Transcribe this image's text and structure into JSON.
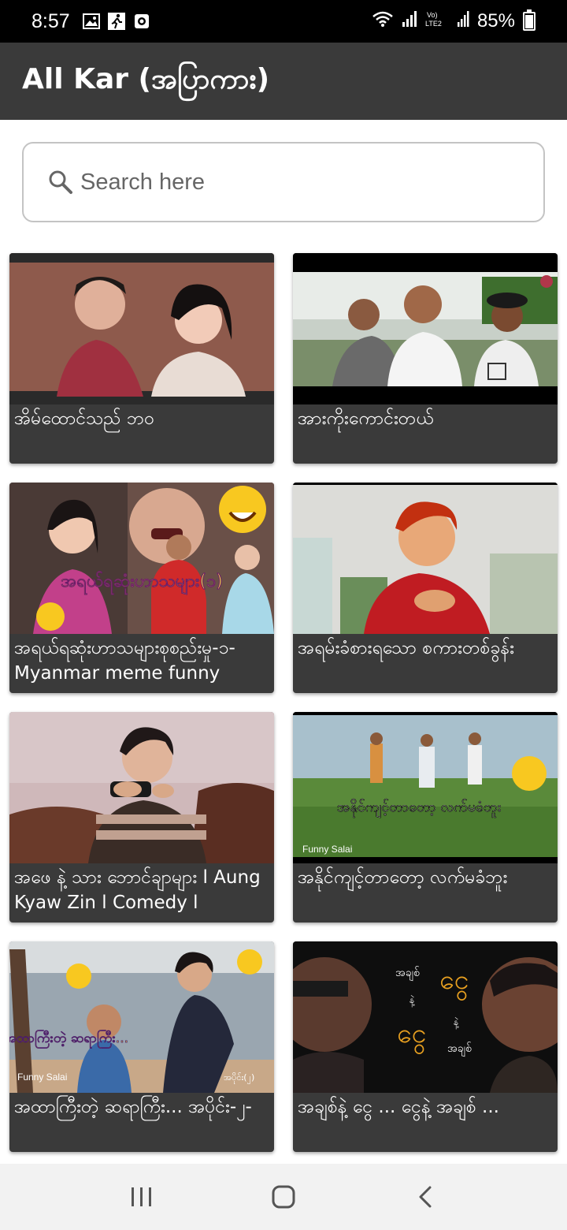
{
  "status_bar": {
    "time": "8:57",
    "battery": "85%",
    "battery_level": 0.85,
    "icons": [
      "gallery-icon",
      "running-app-icon",
      "record-icon",
      "wifi-icon",
      "signal-icon",
      "volte-icon",
      "signal-2-icon",
      "battery-icon"
    ],
    "volte_label": "Vo)\nLTE2"
  },
  "app_bar": {
    "title": "All Kar (အပြာကား)",
    "background": "#3a3a3a"
  },
  "search": {
    "placeholder": "Search here",
    "value": ""
  },
  "videos": [
    {
      "title": "အိမ်ထောင်သည် ဘဝ"
    },
    {
      "title": "အားကိုးကောင်းတယ်"
    },
    {
      "title": "အရယ်ရဆုံးဟာသများစုစည်းမှု-၁- Myanmar meme funny",
      "overlay": "အရယ်ရဆုံးဟာသများ(၁)"
    },
    {
      "title": "အရမ်းခံစားရသော စကားတစ်ခွန်း"
    },
    {
      "title": "အဖေ နဲ့ သား ဘောင်ချာများ l Aung Kyaw Zin l Comedy l"
    },
    {
      "title": "အနိုင်ကျင့်တာတော့ လက်မခံဘူး",
      "overlay": "အနိုင်ကျင့်တာတော့ လက်မခံဘူး",
      "watermark": "Funny Salai"
    },
    {
      "title": "အထာကြီးတဲ့ ဆရာကြီး... အပိုင်း-၂-",
      "overlay": "အထာကြီးတဲ့ ဆရာကြီး...",
      "watermark": "Funny Salai",
      "tag": "အပိုင်း(၂)"
    },
    {
      "title": "အချစ်နဲ့ ငွေ ... ငွေနဲ့ အချစ် ...",
      "overlay_words": [
        "အချစ်",
        "ငွေ",
        "နဲ့",
        "ငွေ",
        "နဲ့",
        "အချစ်"
      ]
    }
  ],
  "nav_bar": {
    "buttons": [
      "recents-icon",
      "home-icon",
      "back-icon"
    ]
  }
}
